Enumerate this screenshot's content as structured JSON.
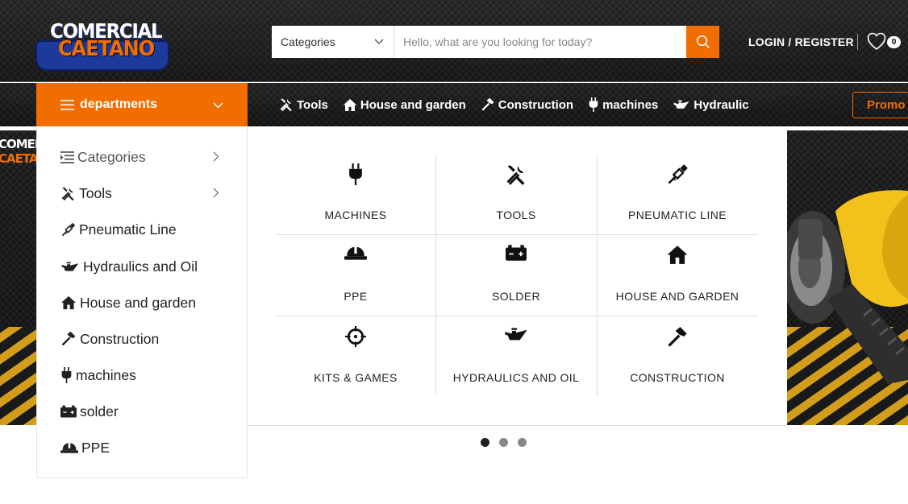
{
  "header": {
    "logo": {
      "line1": "COMERCIAL",
      "line2": "CAETANO"
    },
    "search": {
      "category_label": "Categories",
      "placeholder": "Hello, what are you looking for today?"
    },
    "login_label": "LOGIN / REGISTER",
    "wishlist_count": "0"
  },
  "nav": {
    "departments_label": "departments",
    "links": [
      {
        "label": "Tools",
        "icon": "tools-icon"
      },
      {
        "label": "House and garden",
        "icon": "house-icon"
      },
      {
        "label": "Construction",
        "icon": "hammer-icon"
      },
      {
        "label": "machines",
        "icon": "plug-icon"
      },
      {
        "label": "Hydraulic",
        "icon": "oil-can-icon"
      }
    ],
    "promo_label": "Promo"
  },
  "departments_menu": [
    {
      "label": "Categories",
      "icon": "categories-icon",
      "has_submenu": true
    },
    {
      "label": "Tools",
      "icon": "tools-icon",
      "has_submenu": true
    },
    {
      "label": "Pneumatic Line",
      "icon": "pneumatic-icon",
      "has_submenu": false
    },
    {
      "label": "Hydraulics and Oil",
      "icon": "oil-can-icon",
      "has_submenu": false
    },
    {
      "label": "House and garden",
      "icon": "house-icon",
      "has_submenu": false
    },
    {
      "label": "Construction",
      "icon": "hammer-icon",
      "has_submenu": false
    },
    {
      "label": "machines",
      "icon": "plug-icon",
      "has_submenu": false
    },
    {
      "label": "solder",
      "icon": "battery-icon",
      "has_submenu": false
    },
    {
      "label": "PPE",
      "icon": "helmet-icon",
      "has_submenu": false
    }
  ],
  "mega_grid": [
    {
      "label": "MACHINES",
      "icon": "plug-icon"
    },
    {
      "label": "TOOLS",
      "icon": "tools-icon"
    },
    {
      "label": "PNEUMATIC LINE",
      "icon": "pneumatic-icon"
    },
    {
      "label": "PPE",
      "icon": "helmet-icon"
    },
    {
      "label": "SOLDER",
      "icon": "battery-icon"
    },
    {
      "label": "HOUSE AND GARDEN",
      "icon": "house-icon"
    },
    {
      "label": "KITS & GAMES",
      "icon": "crosshair-icon"
    },
    {
      "label": "HYDRAULICS AND OIL",
      "icon": "oil-can-icon"
    },
    {
      "label": "CONSTRUCTION",
      "icon": "hammer-icon"
    }
  ],
  "hero": {
    "mini_logo_line1": "COMERCIAL",
    "mini_logo_line2": "CAETANO",
    "slide_count": 3,
    "active_slide": 1
  },
  "colors": {
    "accent": "#f26d00",
    "dark": "#1a1a1a",
    "logo_blue": "#1d3a9b"
  }
}
